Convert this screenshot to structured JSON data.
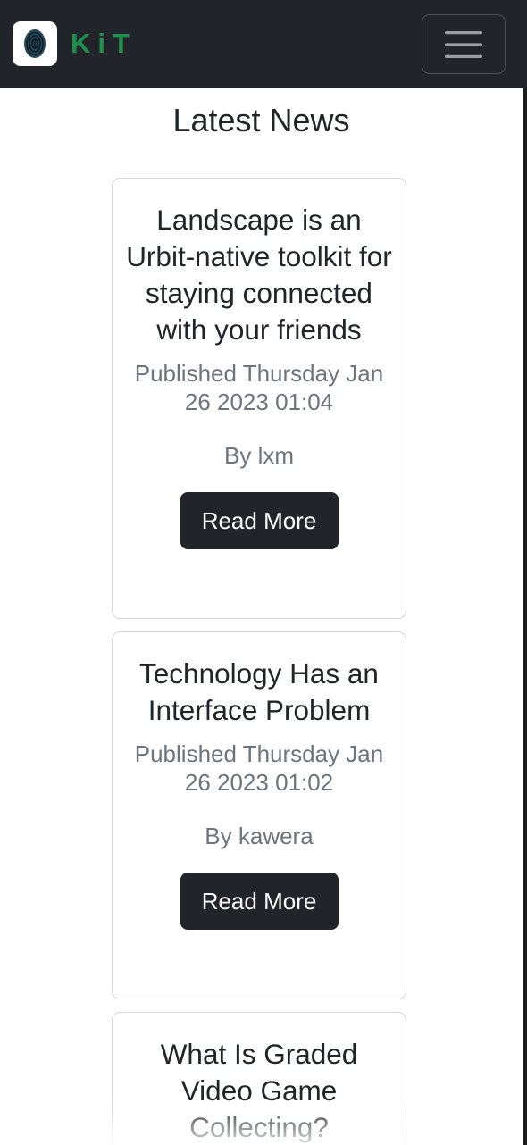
{
  "navbar": {
    "brand_text": "KiT",
    "logo_icon": "fingerprint-logo-icon",
    "menu_icon": "hamburger-menu-icon",
    "background": "#212529",
    "brand_color": "#1f8f4c"
  },
  "main": {
    "heading": "Latest News",
    "articles": [
      {
        "title": "Landscape is an Urbit-native toolkit for staying connected with your friends",
        "published": "Published Thursday Jan 26 2023 01:04",
        "author": "By lxm",
        "button_label": "Read More"
      },
      {
        "title": "Technology Has an Interface Problem",
        "published": "Published Thursday Jan 26 2023 01:02",
        "author": "By kawera",
        "button_label": "Read More"
      },
      {
        "title": "What Is Graded Video Game Collecting?"
      }
    ]
  }
}
